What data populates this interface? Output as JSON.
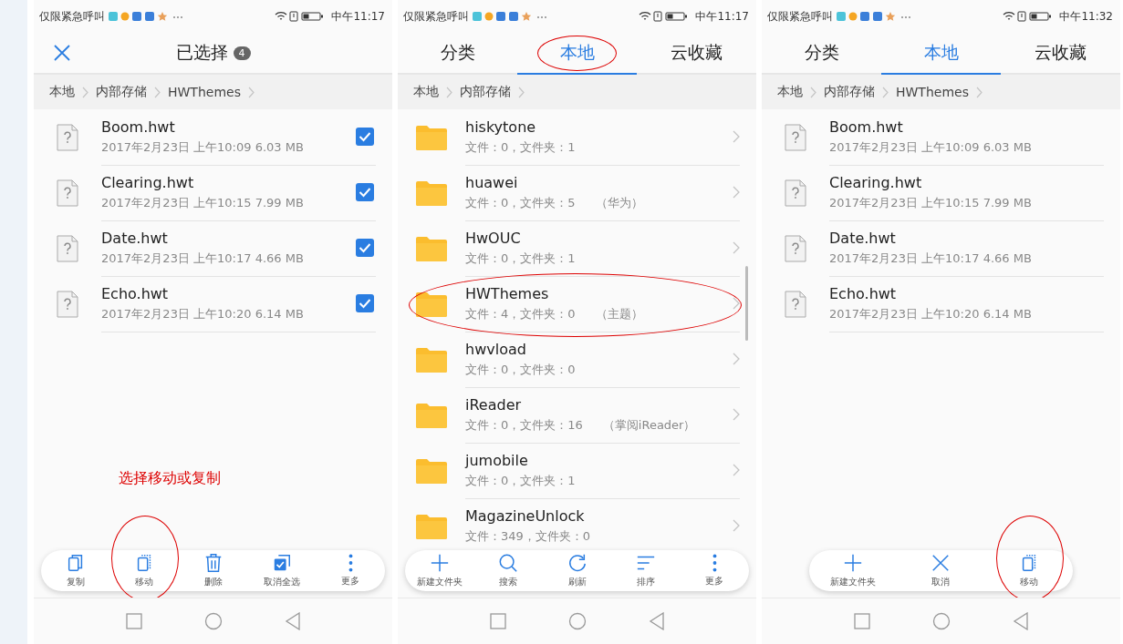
{
  "panels": [
    {
      "status_bar": {
        "carrier": "仅限紧急呼叫",
        "time": "中午11:17"
      },
      "header": {
        "kind": "selection",
        "title": "已选择",
        "count": "4"
      },
      "breadcrumb": [
        "本地",
        "内部存储",
        "HWThemes"
      ],
      "items": [
        {
          "kind": "file",
          "name": "Boom.hwt",
          "info": "2017年2月23日 上午10:09 6.03 MB",
          "checked": true,
          "circled": false
        },
        {
          "kind": "file",
          "name": "Clearing.hwt",
          "info": "2017年2月23日 上午10:15 7.99 MB",
          "checked": true,
          "circled": false
        },
        {
          "kind": "file",
          "name": "Date.hwt",
          "info": "2017年2月23日 上午10:17 4.66 MB",
          "checked": true,
          "circled": false
        },
        {
          "kind": "file",
          "name": "Echo.hwt",
          "info": "2017年2月23日 上午10:20 6.14 MB",
          "checked": true,
          "circled": false
        }
      ],
      "annotation": "选择移动或复制",
      "toolbar": [
        {
          "kind": "copy",
          "label": "复制",
          "circled": false
        },
        {
          "kind": "move",
          "label": "移动",
          "circled": true
        },
        {
          "kind": "delete",
          "label": "删除",
          "circled": false
        },
        {
          "kind": "check-all",
          "label": "取消全选",
          "circled": false
        },
        {
          "kind": "more",
          "label": "更多",
          "circled": false
        }
      ]
    },
    {
      "status_bar": {
        "carrier": "仅限紧急呼叫",
        "time": "中午11:17"
      },
      "header": {
        "kind": "tabs",
        "tabs": [
          {
            "label": "分类",
            "selected": false,
            "circled": false
          },
          {
            "label": "本地",
            "selected": true,
            "circled": true
          },
          {
            "label": "云收藏",
            "selected": false,
            "circled": false
          }
        ]
      },
      "breadcrumb": [
        "本地",
        "内部存储"
      ],
      "scrollbar": true,
      "items": [
        {
          "kind": "folder",
          "name": "hiskytone",
          "info": "文件：0，文件夹：1",
          "circled": false
        },
        {
          "kind": "folder",
          "name": "huawei",
          "info": "文件：0，文件夹：5",
          "note": "（华为）",
          "circled": false
        },
        {
          "kind": "folder",
          "name": "HwOUC",
          "info": "文件：0，文件夹：1",
          "circled": false
        },
        {
          "kind": "folder",
          "name": "HWThemes",
          "info": "文件：4，文件夹：0",
          "note": "（主题）",
          "circled": true
        },
        {
          "kind": "folder",
          "name": "hwvload",
          "info": "文件：0，文件夹：0",
          "circled": false
        },
        {
          "kind": "folder",
          "name": "iReader",
          "info": "文件：0，文件夹：16",
          "note": "（掌阅iReader）",
          "circled": false
        },
        {
          "kind": "folder",
          "name": "jumobile",
          "info": "文件：0，文件夹：1",
          "circled": false
        },
        {
          "kind": "folder",
          "name": "MagazineUnlock",
          "info": "文件：349，文件夹：0",
          "circled": false
        }
      ],
      "toolbar": [
        {
          "kind": "new-folder",
          "label": "新建文件夹",
          "circled": false
        },
        {
          "kind": "search",
          "label": "搜索",
          "circled": false
        },
        {
          "kind": "refresh",
          "label": "刷新",
          "circled": false
        },
        {
          "kind": "sort",
          "label": "排序",
          "circled": false
        },
        {
          "kind": "more",
          "label": "更多",
          "circled": false
        }
      ]
    },
    {
      "status_bar": {
        "carrier": "仅限紧急呼叫",
        "time": "中午11:32"
      },
      "header": {
        "kind": "tabs",
        "tabs": [
          {
            "label": "分类",
            "selected": false,
            "circled": false
          },
          {
            "label": "本地",
            "selected": true,
            "circled": false
          },
          {
            "label": "云收藏",
            "selected": false,
            "circled": false
          }
        ]
      },
      "breadcrumb": [
        "本地",
        "内部存储",
        "HWThemes"
      ],
      "items": [
        {
          "kind": "file",
          "name": "Boom.hwt",
          "info": "2017年2月23日 上午10:09 6.03 MB",
          "circled": false
        },
        {
          "kind": "file",
          "name": "Clearing.hwt",
          "info": "2017年2月23日 上午10:15 7.99 MB",
          "circled": false
        },
        {
          "kind": "file",
          "name": "Date.hwt",
          "info": "2017年2月23日 上午10:17 4.66 MB",
          "circled": false
        },
        {
          "kind": "file",
          "name": "Echo.hwt",
          "info": "2017年2月23日 上午10:20 6.14 MB",
          "circled": false
        }
      ],
      "toolbar": [
        {
          "kind": "new-folder",
          "label": "新建文件夹",
          "circled": false
        },
        {
          "kind": "cancel",
          "label": "取消",
          "circled": false
        },
        {
          "kind": "move",
          "label": "移动",
          "circled": true
        }
      ]
    }
  ]
}
